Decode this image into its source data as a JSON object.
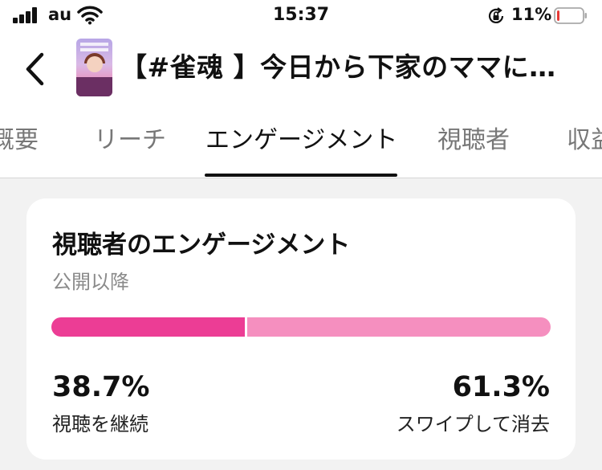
{
  "status_bar": {
    "carrier": "au",
    "time": "15:37",
    "battery_percent": "11%",
    "battery_level": 0.11,
    "battery_color": "#e53935",
    "icons": [
      "signal-icon",
      "wifi-icon",
      "orientation-lock-icon",
      "battery-icon"
    ]
  },
  "header": {
    "back_icon": "chevron-left-icon",
    "video_title": "【#雀魂 】今日から下家のママに…"
  },
  "tabs": [
    {
      "label": "概要",
      "active": false
    },
    {
      "label": "リーチ",
      "active": false
    },
    {
      "label": "エンゲージメント",
      "active": true
    },
    {
      "label": "視聴者",
      "active": false
    },
    {
      "label": "収益",
      "active": false
    }
  ],
  "engagement_card": {
    "title": "視聴者のエンゲージメント",
    "subtitle": "公開以降",
    "continue_fraction": 0.387,
    "swipe_fraction": 0.613,
    "continue_color": "#ec3d95",
    "swipe_color": "#f58fbf",
    "continue_percent": "38.7%",
    "continue_label": "視聴を継続",
    "swipe_percent": "61.3%",
    "swipe_label": "スワイプして消去"
  }
}
